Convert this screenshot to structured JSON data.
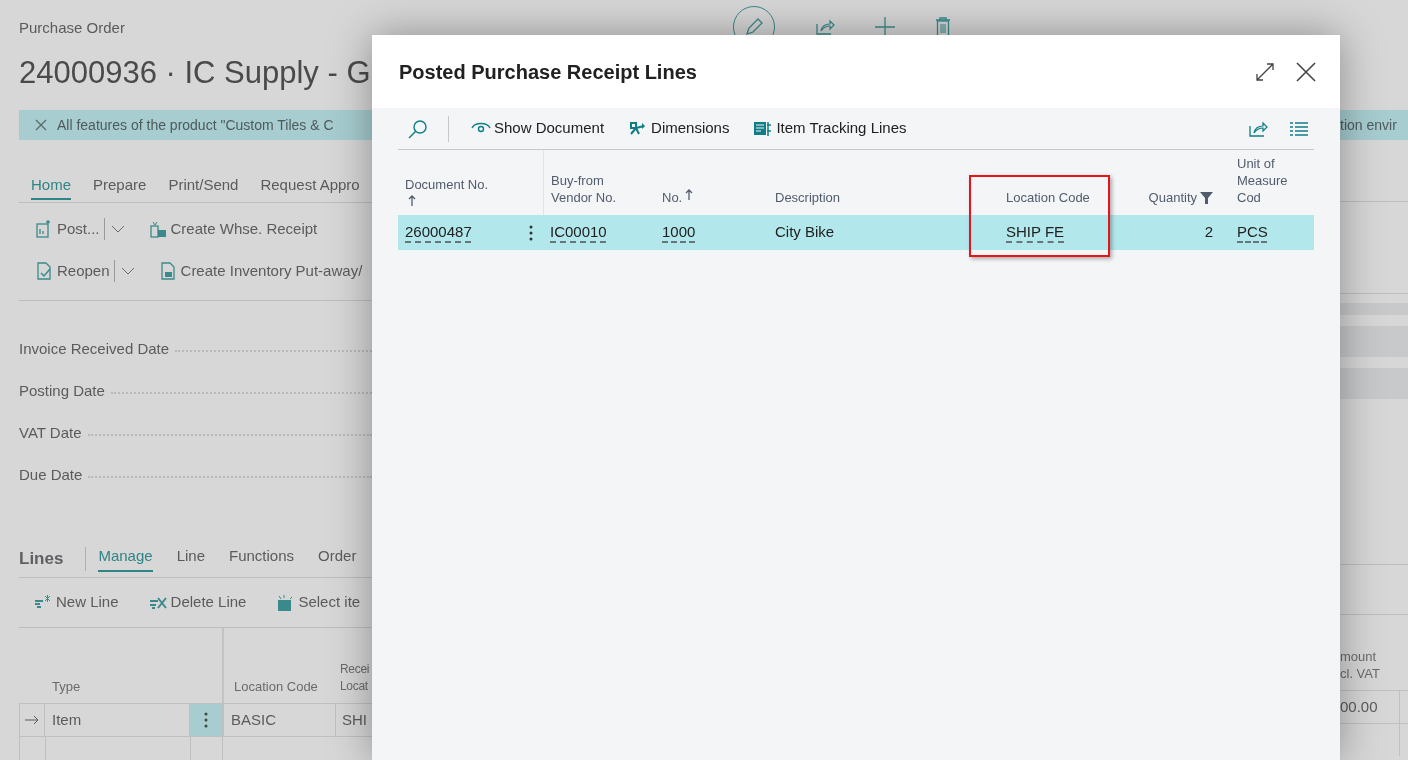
{
  "page": {
    "caption": "Purchase Order",
    "title": "24000936 · IC Supply - G",
    "banner": {
      "text": "All features of the product \"Custom Tiles & C",
      "text_right": "tion envir"
    },
    "tabs": [
      {
        "label": "Home",
        "selected": true
      },
      {
        "label": "Prepare",
        "selected": false
      },
      {
        "label": "Print/Send",
        "selected": false
      },
      {
        "label": "Request Appro",
        "selected": false
      }
    ],
    "actions": [
      [
        {
          "label": "Post...",
          "split": true
        },
        {
          "label": "Create Whse. Receipt",
          "split": false
        }
      ],
      [
        {
          "label": "Reopen",
          "split": true
        },
        {
          "label": "Create Inventory Put-away/",
          "split": false
        }
      ]
    ],
    "fields": [
      "Invoice Received Date",
      "Posting Date",
      "VAT Date",
      "Due Date"
    ],
    "lines": {
      "title": "Lines",
      "tabs": [
        {
          "label": "Manage",
          "selected": true
        },
        {
          "label": "Line",
          "selected": false
        },
        {
          "label": "Functions",
          "selected": false
        },
        {
          "label": "Order",
          "selected": false
        }
      ],
      "actions": [
        "New Line",
        "Delete Line",
        "Select ite"
      ],
      "columns": [
        "Type",
        "Location Code",
        "Recei\nLocat"
      ],
      "rows": [
        {
          "current": true,
          "cells": [
            "Item",
            "BASIC",
            "SHI"
          ]
        }
      ],
      "right_column": "mount\ncl. VAT",
      "right_cell": "00.00"
    }
  },
  "dialog": {
    "title": "Posted Purchase Receipt Lines",
    "actions": [
      "Show Document",
      "Dimensions",
      "Item Tracking Lines"
    ],
    "columns": [
      {
        "label": "Document No.",
        "sorted": true,
        "filtered": false,
        "link": true,
        "highlighted": false
      },
      {
        "label": "Buy-from\nVendor No.",
        "sorted": false,
        "filtered": false,
        "link": true,
        "highlighted": false
      },
      {
        "label": "No.",
        "sorted": true,
        "filtered": false,
        "link": true,
        "highlighted": false
      },
      {
        "label": "Description",
        "sorted": false,
        "filtered": false,
        "link": false,
        "highlighted": false
      },
      {
        "label": "Location Code",
        "sorted": false,
        "filtered": false,
        "link": true,
        "highlighted": true
      },
      {
        "label": "Quantity",
        "sorted": false,
        "filtered": true,
        "link": false,
        "highlighted": false
      },
      {
        "label": "Unit of\nMeasure Cod",
        "sorted": false,
        "filtered": false,
        "link": true,
        "highlighted": false
      }
    ],
    "rows": [
      {
        "selected": true,
        "cells": [
          "26000487",
          "IC00010",
          "1000",
          "City Bike",
          "SHIP FE",
          "2",
          "PCS"
        ]
      }
    ]
  }
}
